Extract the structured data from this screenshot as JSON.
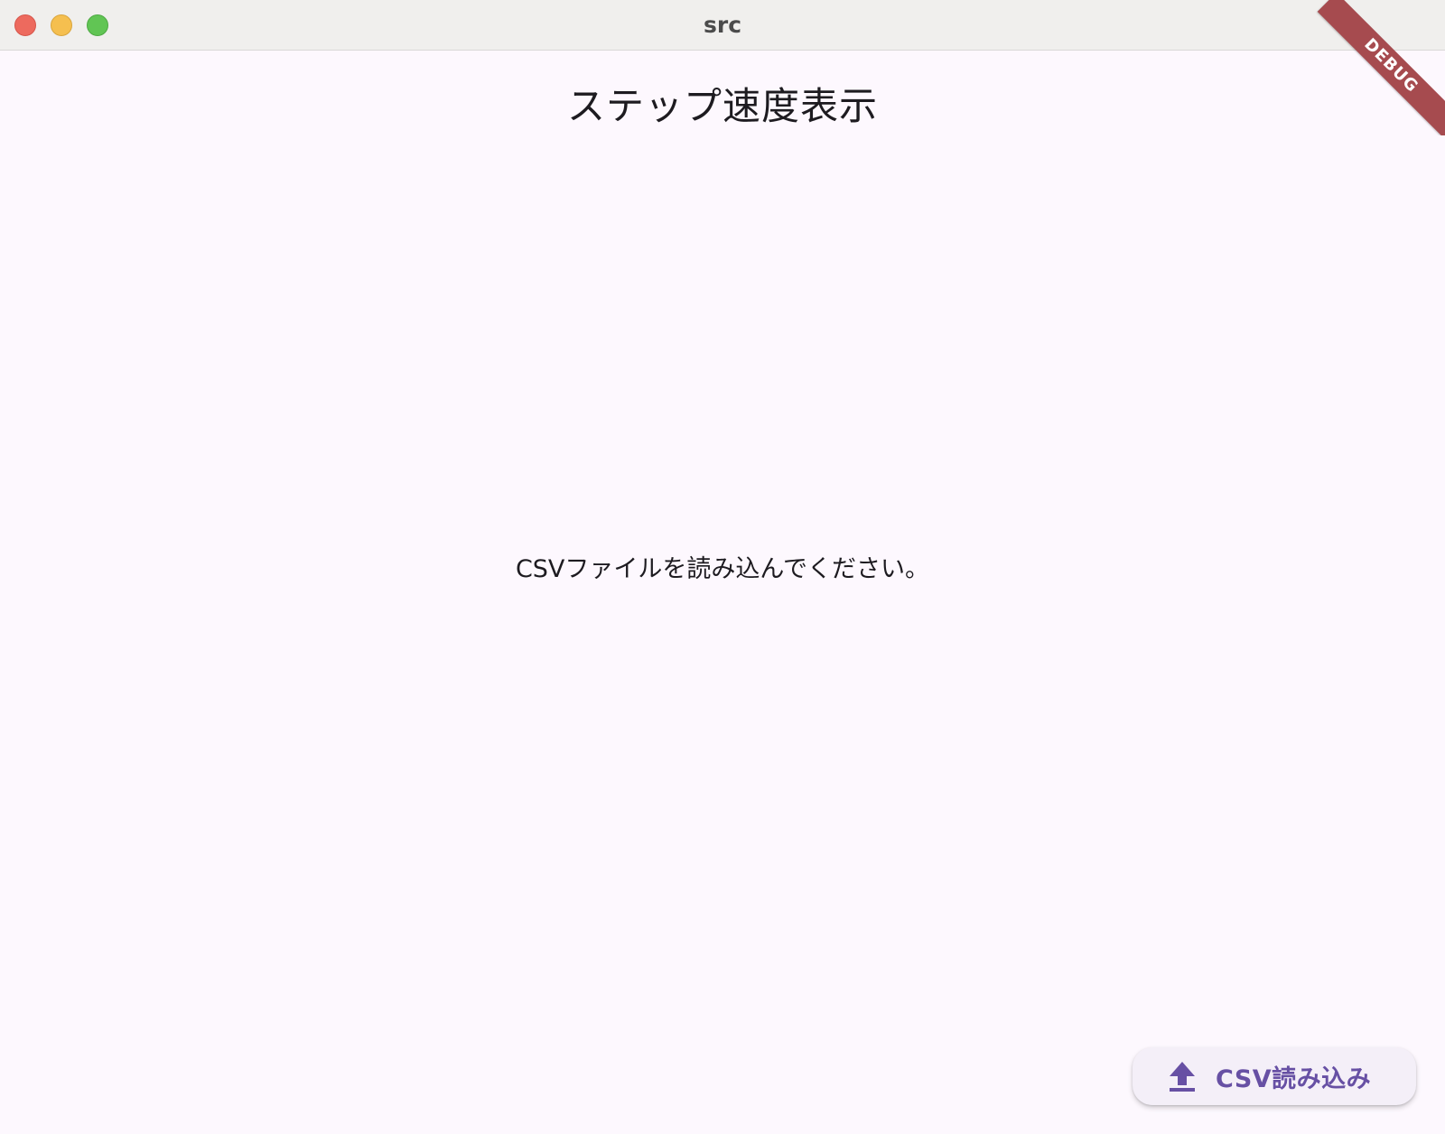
{
  "window": {
    "title": "src"
  },
  "app": {
    "title": "ステップ速度表示",
    "empty_message": "CSVファイルを読み込んでください。",
    "debug_banner": "DEBUG"
  },
  "fab": {
    "label": "CSV読み込み",
    "icon": "upload-icon"
  },
  "colors": {
    "accent": "#6750a4",
    "background": "#fdf8fe",
    "fab_background": "#f4eff8",
    "debug_ribbon": "#a64b4f"
  }
}
